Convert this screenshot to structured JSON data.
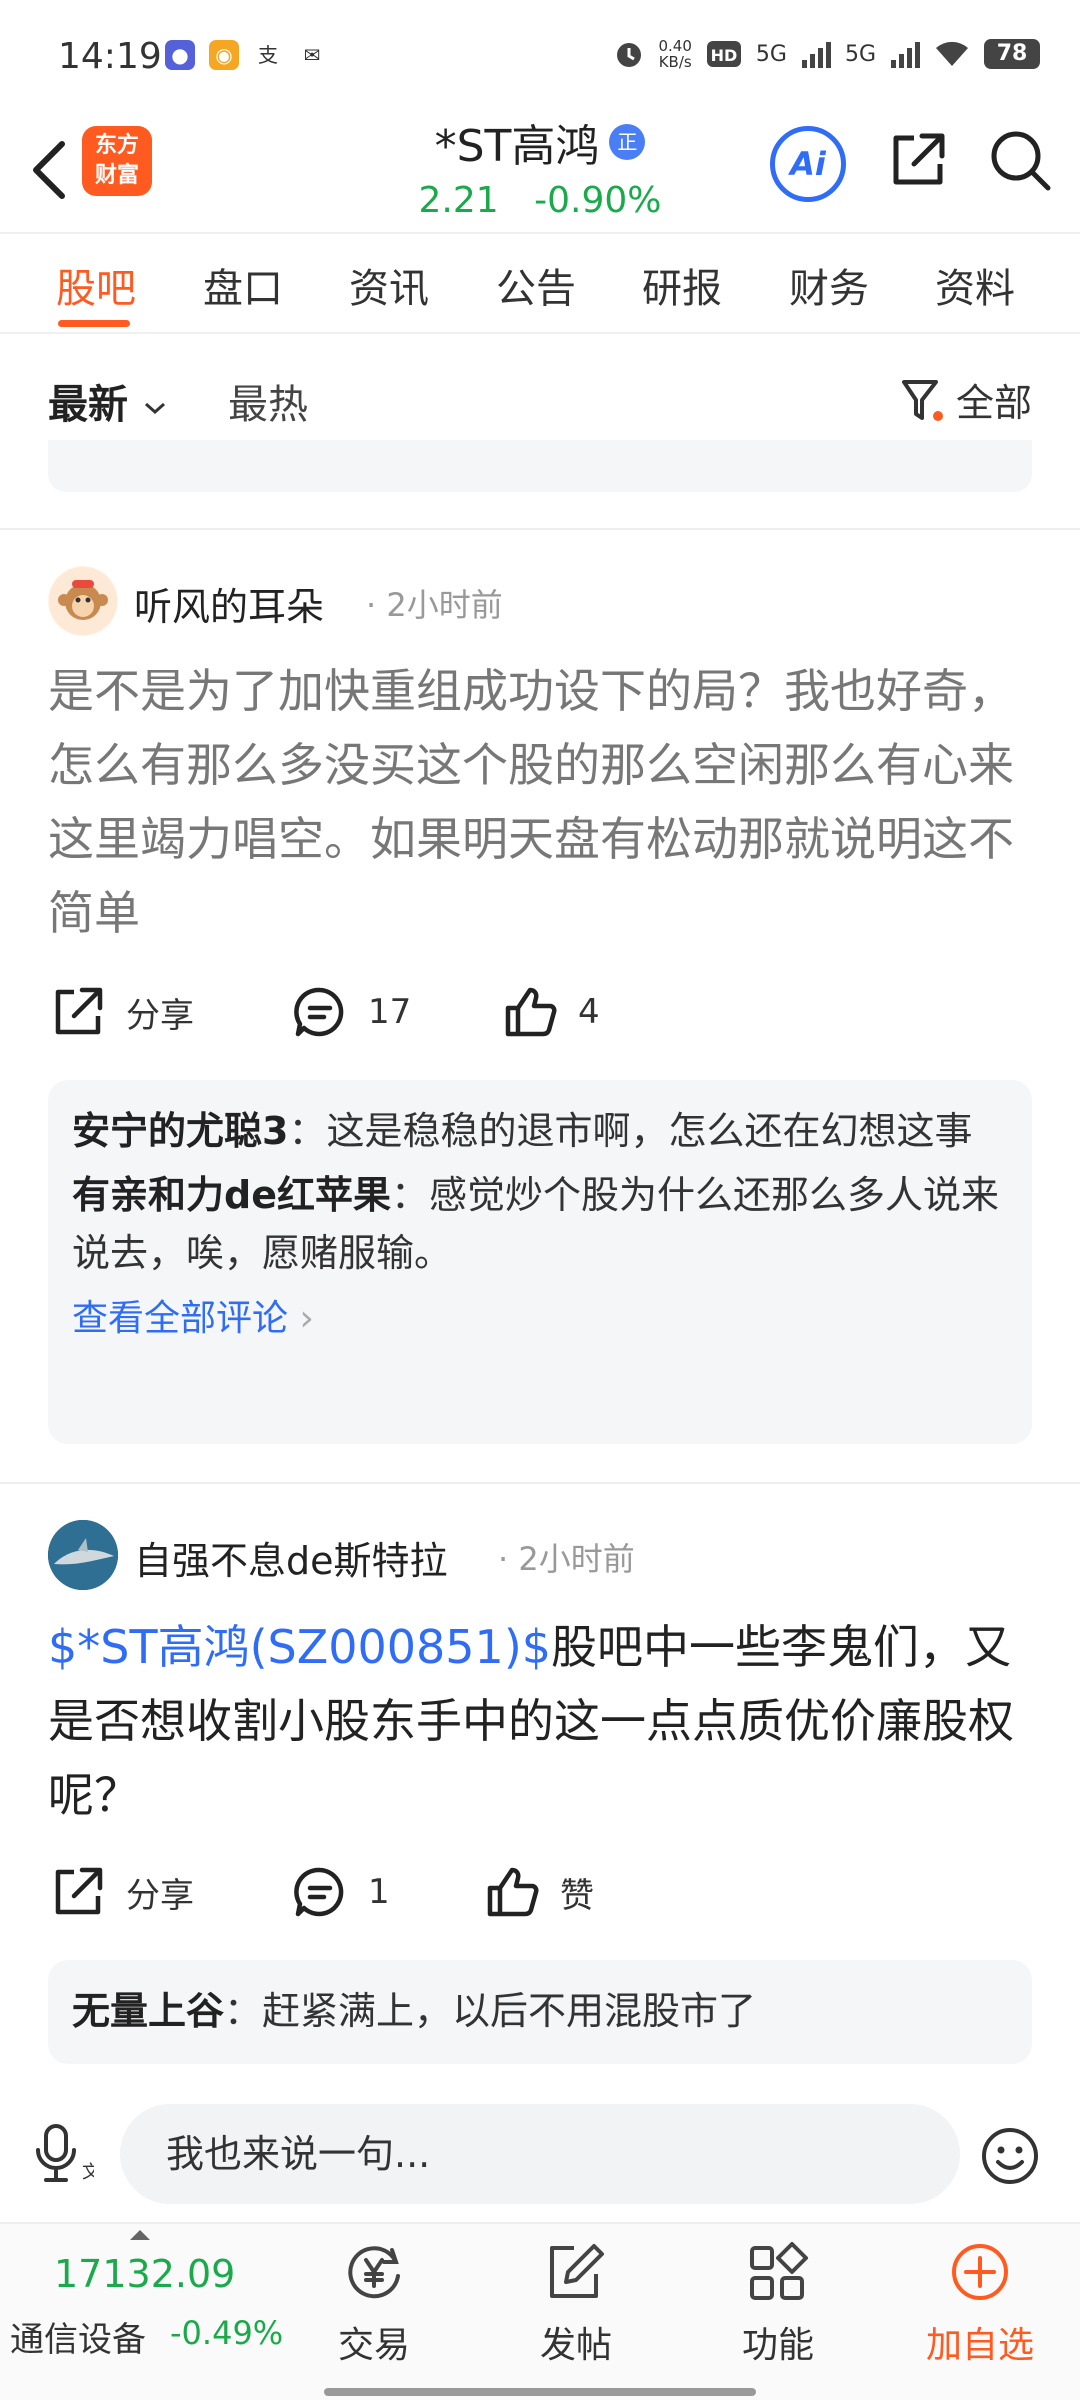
{
  "status_bar": {
    "time": "14:19",
    "net_speed_value": "0.40",
    "net_speed_unit": "KB/s",
    "signal1": "5G",
    "signal2": "5G",
    "battery": "78"
  },
  "header": {
    "logo_line1": "东方",
    "logo_line2": "财富",
    "stock_name": "*ST高鸿",
    "badge": "正",
    "price": "2.21",
    "change": "-0.90%",
    "ai_label": "Ai",
    "price_color": "#1aaa4b",
    "accent_color": "#ff5a1f"
  },
  "tabs": [
    {
      "label": "股吧",
      "active": true
    },
    {
      "label": "盘口"
    },
    {
      "label": "资讯"
    },
    {
      "label": "公告"
    },
    {
      "label": "研报"
    },
    {
      "label": "财务"
    },
    {
      "label": "资料"
    }
  ],
  "sort": {
    "latest": "最新",
    "hot": "最热",
    "filter": "全部"
  },
  "posts": [
    {
      "author": "听风的耳朵",
      "time": "2小时前",
      "body": "是不是为了加快重组成功设下的局？我也好奇，怎么有那么多没买这个股的那么空闲那么有心来这里竭力唱空。如果明天盘有松动那就说明这不简单",
      "share": "分享",
      "comments": "17",
      "likes": "4",
      "replies": [
        {
          "user": "安宁的尤聪3",
          "text": "：这是稳稳的退市啊，怎么还在幻想这事"
        },
        {
          "user": "有亲和力de红苹果",
          "text": "：感觉炒个股为什么还那么多人说来说去，唉，愿赌服输。"
        }
      ],
      "view_all": "查看全部评论"
    },
    {
      "author": "自强不息de斯特拉",
      "time": "2小时前",
      "link": "$*ST高鸿(SZ000851)$",
      "body": "股吧中一些李鬼们，又是否想收割小股东手中的这一点点质优价廉股权呢？",
      "share": "分享",
      "comments": "1",
      "likes": "赞",
      "replies": [
        {
          "user": "无量上谷",
          "text": "：赶紧满上，以后不用混股市了"
        }
      ]
    }
  ],
  "composer": {
    "placeholder": "我也来说一句..."
  },
  "bottom": {
    "index_value": "17132.09",
    "index_name": "通信设备",
    "index_change": "-0.49%",
    "nav": [
      "交易",
      "发帖",
      "功能",
      "加自选"
    ]
  }
}
